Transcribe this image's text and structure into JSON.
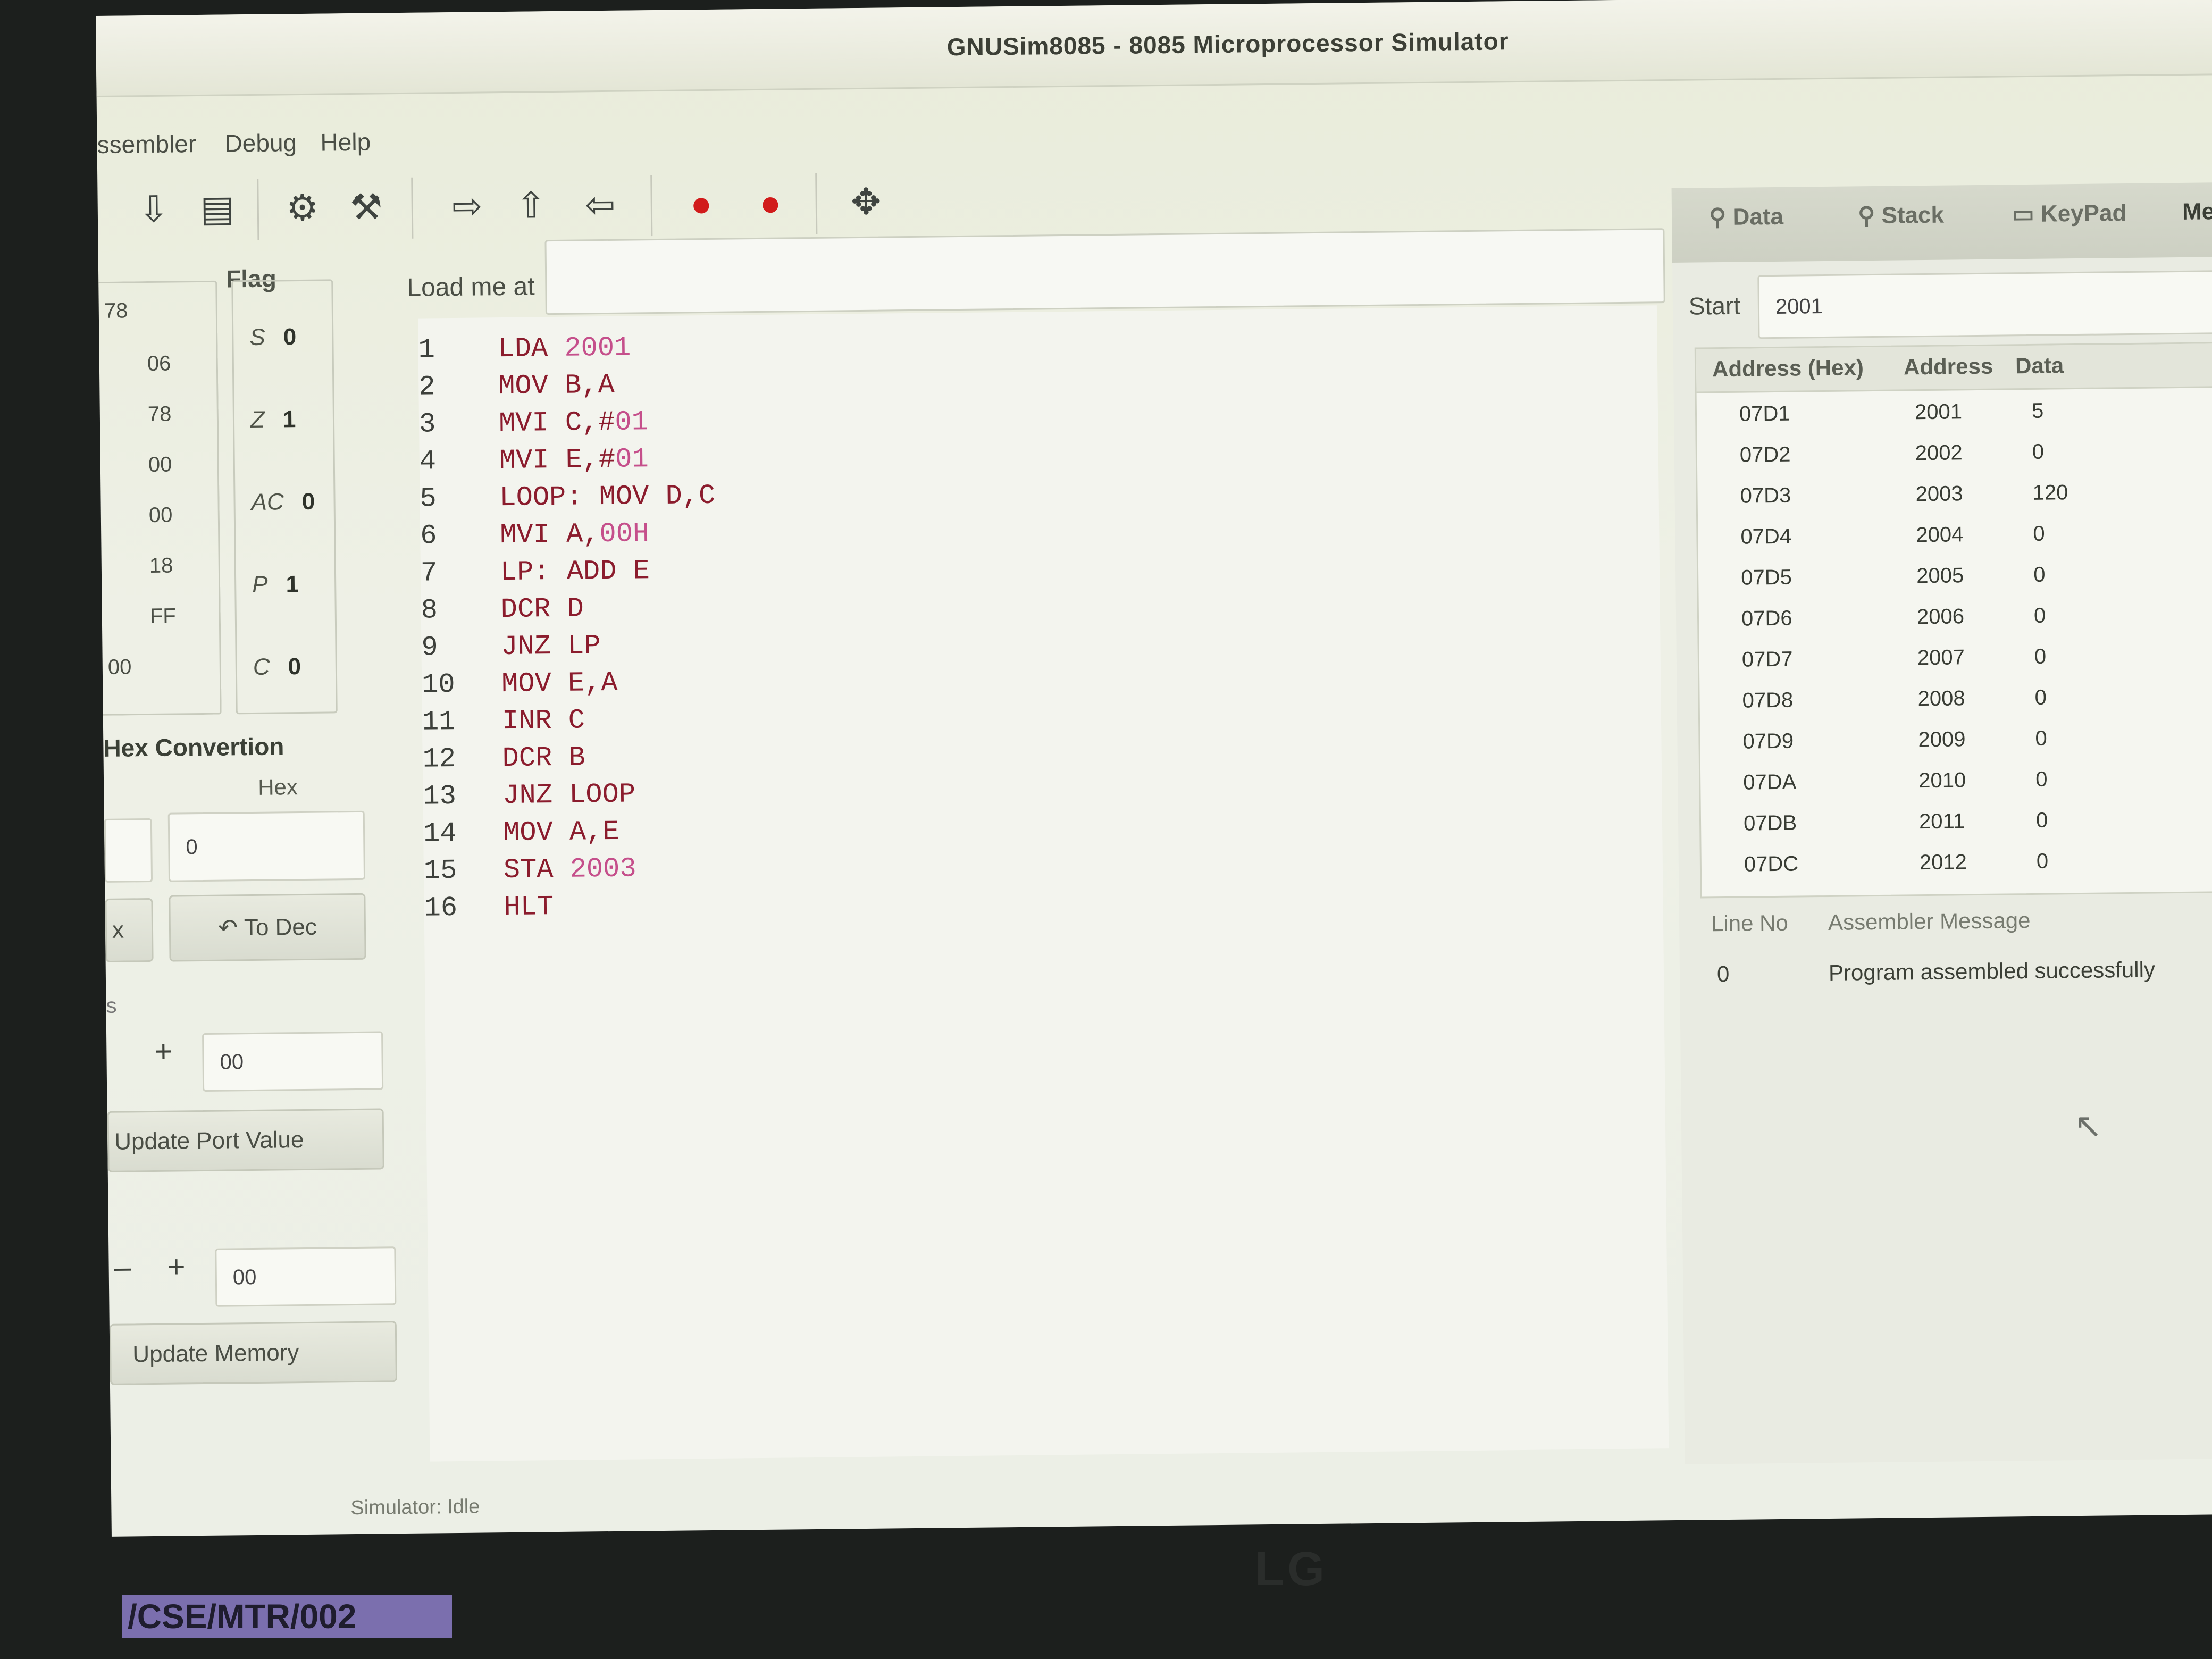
{
  "window": {
    "title": "GNUSim8085 - 8085 Microprocessor Simulator"
  },
  "menu": {
    "items": [
      "ssembler",
      "Debug",
      "Help"
    ]
  },
  "toolbar": {
    "icons": [
      "save-icon",
      "save-as-icon",
      "assemble-icon",
      "execute-icon",
      "step-in-icon",
      "step-over-icon",
      "step-out-icon",
      "breakpoint-icon",
      "stop-icon",
      "help-icon"
    ],
    "colors": {
      "breakpoint": "#d11b1b"
    }
  },
  "registers": {
    "values": [
      "78",
      "06",
      "78",
      "00",
      "00",
      "18",
      "FF",
      "00"
    ]
  },
  "flags": {
    "title": "Flag",
    "items": [
      {
        "name": "S",
        "value": "0"
      },
      {
        "name": "Z",
        "value": "1"
      },
      {
        "name": "AC",
        "value": "0"
      },
      {
        "name": "P",
        "value": "1"
      },
      {
        "name": "C",
        "value": "0"
      }
    ]
  },
  "hex_conversion": {
    "title": "Hex Convertion",
    "hex_label": "Hex",
    "hex_value": "0",
    "left_button": "x",
    "to_dec_button": "To Dec"
  },
  "io_port": {
    "label": "s",
    "plus": "+",
    "value": "00",
    "update_button": "Update Port Value"
  },
  "memory_edit": {
    "minus": "–",
    "plus": "+",
    "value": "00",
    "update_button": "Update Memory"
  },
  "editor": {
    "load_label": "Load me at",
    "lines": [
      {
        "n": "1",
        "kw": "LDA ",
        "arg": "2001"
      },
      {
        "n": "2",
        "kw": "MOV B,A",
        "arg": ""
      },
      {
        "n": "3",
        "kw": "MVI C,#",
        "arg": "01"
      },
      {
        "n": "4",
        "kw": "MVI E,#",
        "arg": "01"
      },
      {
        "n": "5",
        "kw": "LOOP: MOV D,C",
        "arg": ""
      },
      {
        "n": "6",
        "kw": "MVI A,",
        "arg": "00H"
      },
      {
        "n": "7",
        "kw": "LP: ADD E",
        "arg": ""
      },
      {
        "n": "8",
        "kw": "DCR D",
        "arg": ""
      },
      {
        "n": "9",
        "kw": "JNZ LP",
        "arg": ""
      },
      {
        "n": "10",
        "kw": "MOV E,A",
        "arg": ""
      },
      {
        "n": "11",
        "kw": "INR C",
        "arg": ""
      },
      {
        "n": "12",
        "kw": "DCR B",
        "arg": ""
      },
      {
        "n": "13",
        "kw": "JNZ LOOP",
        "arg": ""
      },
      {
        "n": "14",
        "kw": "MOV A,E",
        "arg": ""
      },
      {
        "n": "15",
        "kw": "STA ",
        "arg": "2003"
      },
      {
        "n": "16",
        "kw": "HLT",
        "arg": ""
      }
    ]
  },
  "right_panel": {
    "tabs": [
      "Data",
      "Stack",
      "KeyPad",
      "Me"
    ],
    "start_label": "Start",
    "start_value": "2001",
    "table_headers": [
      "Address (Hex)",
      "Address",
      "Data"
    ],
    "rows": [
      [
        "07D1",
        "2001",
        "5"
      ],
      [
        "07D2",
        "2002",
        "0"
      ],
      [
        "07D3",
        "2003",
        "120"
      ],
      [
        "07D4",
        "2004",
        "0"
      ],
      [
        "07D5",
        "2005",
        "0"
      ],
      [
        "07D6",
        "2006",
        "0"
      ],
      [
        "07D7",
        "2007",
        "0"
      ],
      [
        "07D8",
        "2008",
        "0"
      ],
      [
        "07D9",
        "2009",
        "0"
      ],
      [
        "07DA",
        "2010",
        "0"
      ],
      [
        "07DB",
        "2011",
        "0"
      ],
      [
        "07DC",
        "2012",
        "0"
      ]
    ],
    "message_headers": [
      "Line No",
      "Assembler Message"
    ],
    "message_line": "0",
    "message_text": "Program assembled successfully"
  },
  "status": {
    "text": "Simulator: Idle"
  },
  "taskbar": {
    "label": "/CSE/MTR/002"
  },
  "monitor": {
    "brand": "LG"
  }
}
